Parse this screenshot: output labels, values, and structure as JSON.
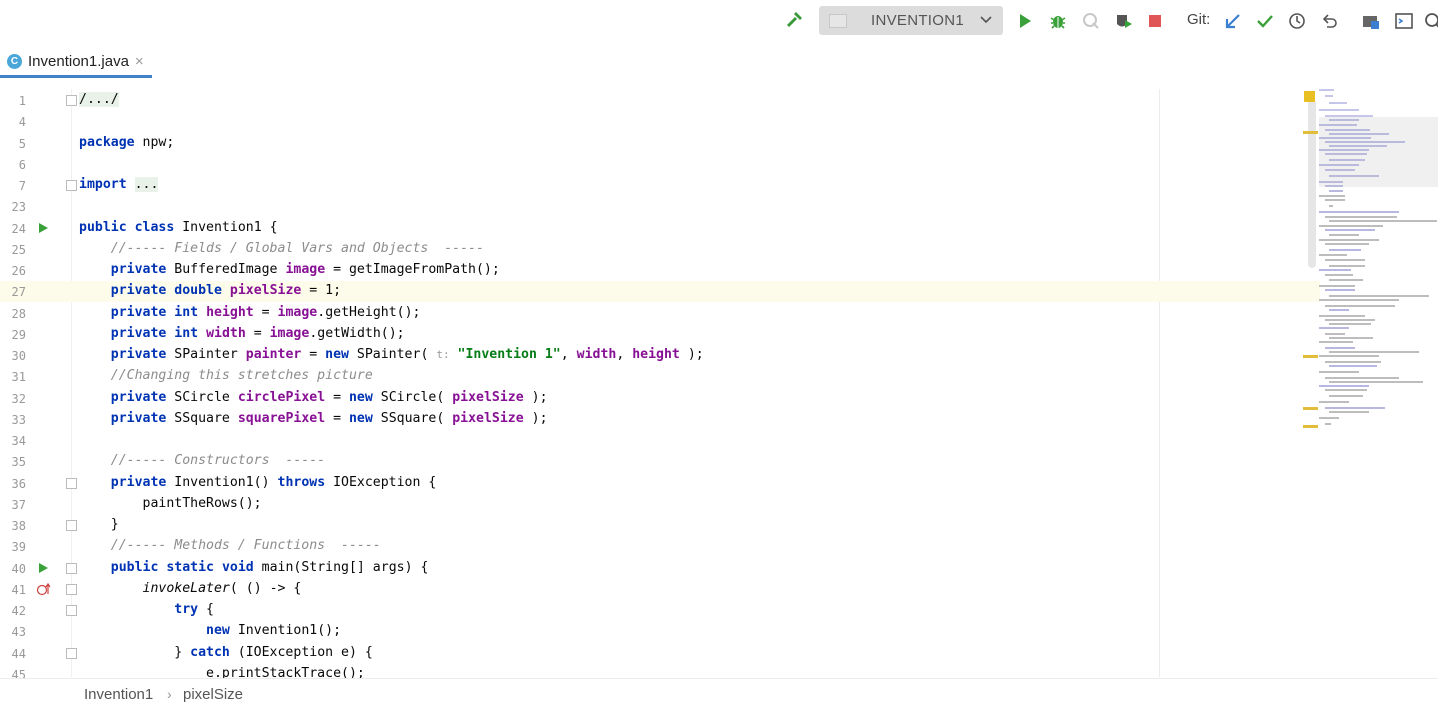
{
  "toolbar": {
    "run_config_label": "INVENTION1",
    "git_label": "Git:",
    "icons": [
      "hammer-icon",
      "run-icon",
      "debug-icon",
      "coverage-icon",
      "profile-icon",
      "stop-icon",
      "git-update-icon",
      "git-commit-icon",
      "history-icon",
      "rollback-icon",
      "project-structure-icon",
      "terminal-icon",
      "search-icon"
    ]
  },
  "tab": {
    "label": "Invention1.java",
    "icon": "C",
    "close": "×"
  },
  "editor": {
    "current_line": "27",
    "lines": [
      {
        "n": "1",
        "t": "/.../"
      },
      {
        "n": "4",
        "t": ""
      },
      {
        "n": "5",
        "t": "package npw;"
      },
      {
        "n": "6",
        "t": ""
      },
      {
        "n": "7",
        "t": "import ..."
      },
      {
        "n": "23",
        "t": ""
      },
      {
        "n": "24",
        "t": "public class Invention1 {"
      },
      {
        "n": "25",
        "t": "    //----- Fields / Global Vars and Objects  -----"
      },
      {
        "n": "26",
        "t": "    private BufferedImage image = getImageFromPath();"
      },
      {
        "n": "27",
        "t": "    private double pixelSize = 1;"
      },
      {
        "n": "28",
        "t": "    private int height = image.getHeight();"
      },
      {
        "n": "29",
        "t": "    private int width = image.getWidth();"
      },
      {
        "n": "30",
        "t": "    private SPainter painter = new SPainter( t: \"Invention 1\", width, height );"
      },
      {
        "n": "31",
        "t": "    //Changing this stretches picture"
      },
      {
        "n": "32",
        "t": "    private SCircle circlePixel = new SCircle( pixelSize );"
      },
      {
        "n": "33",
        "t": "    private SSquare squarePixel = new SSquare( pixelSize );"
      },
      {
        "n": "34",
        "t": ""
      },
      {
        "n": "35",
        "t": "    //----- Constructors  -----"
      },
      {
        "n": "36",
        "t": "    private Invention1() throws IOException {"
      },
      {
        "n": "37",
        "t": "        paintTheRows();"
      },
      {
        "n": "38",
        "t": "    }"
      },
      {
        "n": "39",
        "t": "    //----- Methods / Functions  -----"
      },
      {
        "n": "40",
        "t": "    public static void main(String[] args) {"
      },
      {
        "n": "41",
        "t": "        invokeLater( () -> {"
      },
      {
        "n": "42",
        "t": "            try {"
      },
      {
        "n": "43",
        "t": "                new Invention1();"
      },
      {
        "n": "44",
        "t": "            } catch (IOException e) {"
      },
      {
        "n": "45",
        "t": "                e.printStackTrace();"
      }
    ]
  },
  "breadcrumb": {
    "items": [
      "Invention1",
      "pixelSize"
    ]
  },
  "colors": {
    "keyword": "#0033b3",
    "field": "#871094",
    "comment": "#8c8c8c",
    "string": "#067d17",
    "tab_underline": "#4083c9",
    "run_green": "#3aa03a",
    "stop_red": "#e05555"
  }
}
